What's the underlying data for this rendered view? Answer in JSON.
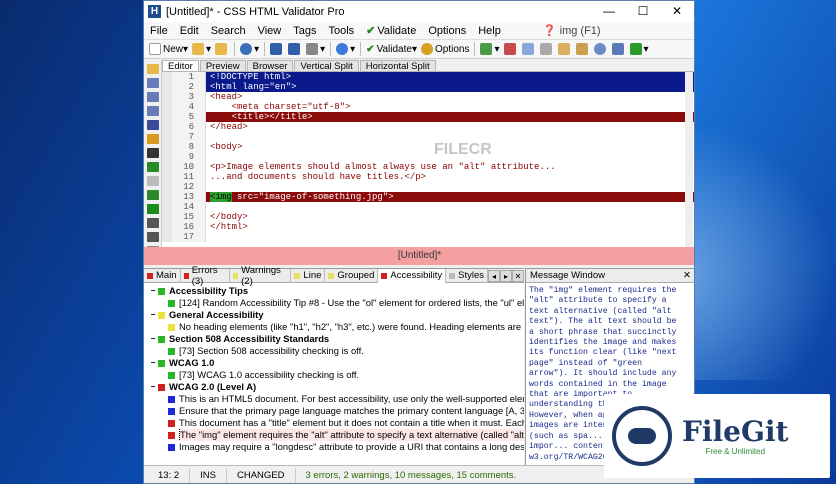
{
  "window": {
    "title": "[Untitled]* - CSS HTML Validator Pro",
    "app_icon_letter": "H",
    "min": "—",
    "max": "☐",
    "close": "✕"
  },
  "menu": {
    "items": [
      "File",
      "Edit",
      "Search",
      "View",
      "Tags",
      "Tools"
    ],
    "validate": "Validate",
    "options": "Options",
    "help": "Help",
    "img_help": "img (F1)"
  },
  "toolbar": {
    "new": "New",
    "validate": "Validate",
    "options": "Options"
  },
  "editor_tabs": [
    "Editor",
    "Preview",
    "Browser",
    "Vertical Split",
    "Horizontal Split"
  ],
  "editor": {
    "lines": [
      {
        "n": "1",
        "t": "<!DOCTYPE html>",
        "s": "sel"
      },
      {
        "n": "2",
        "t": "<html lang=\"en\">",
        "s": "sel"
      },
      {
        "n": "3",
        "t": "<head>",
        "s": ""
      },
      {
        "n": "4",
        "t": "    <meta charset=\"utf-8\">",
        "s": ""
      },
      {
        "n": "5",
        "t": "    <title></title>",
        "s": "err"
      },
      {
        "n": "6",
        "t": "</head>",
        "s": ""
      },
      {
        "n": "7",
        "t": "",
        "s": ""
      },
      {
        "n": "8",
        "t": "<body>",
        "s": ""
      },
      {
        "n": "9",
        "t": "",
        "s": ""
      },
      {
        "n": "10",
        "t": "<p>Image elements should almost always use an \"alt\" attribute...",
        "s": ""
      },
      {
        "n": "11",
        "t": "...and documents should have titles.</p>",
        "s": ""
      },
      {
        "n": "12",
        "t": "",
        "s": ""
      },
      {
        "n": "13",
        "t": " src=\"image-of-something.jpg\">",
        "s": "err",
        "tag": "<img"
      },
      {
        "n": "14",
        "t": "",
        "s": ""
      },
      {
        "n": "15",
        "t": "</body>",
        "s": ""
      },
      {
        "n": "16",
        "t": "</html>",
        "s": ""
      },
      {
        "n": "17",
        "t": "",
        "s": ""
      }
    ]
  },
  "file_tab": "[Untitled]*",
  "bottom_tabs": [
    {
      "label": "Main",
      "color": "#d02020"
    },
    {
      "label": "Errors (3)",
      "color": "#d02020"
    },
    {
      "label": "Warnings (2)",
      "color": "#e8e060"
    },
    {
      "label": "Line",
      "color": "#e8e060"
    },
    {
      "label": "Grouped",
      "color": "#e8e060"
    },
    {
      "label": "Accessibility",
      "color": "#d02020"
    },
    {
      "label": "Styles",
      "color": "#bbbbbb"
    }
  ],
  "tree": [
    {
      "kind": "h",
      "text": "Accessibility Tips",
      "color": "#27b827"
    },
    {
      "kind": "c",
      "text": "[124] Random Accessibility Tip #8 - Use the \"ol\" element for ordered lists, the \"ul\" ele...",
      "color": "#27b827"
    },
    {
      "kind": "h",
      "text": "General Accessibility",
      "color": "#f0e040"
    },
    {
      "kind": "c",
      "text": "No heading elements (like \"h1\", \"h2\", \"h3\", etc.) were found. Heading elements are im...",
      "color": "#f0e040"
    },
    {
      "kind": "h",
      "text": "Section 508 Accessibility Standards",
      "color": "#27b827"
    },
    {
      "kind": "c",
      "text": "[73] Section 508 accessibility checking is off.",
      "color": "#27b827"
    },
    {
      "kind": "h",
      "text": "WCAG 1.0",
      "color": "#27b827"
    },
    {
      "kind": "c",
      "text": "[73] WCAG 1.0 accessibility checking is off.",
      "color": "#27b827"
    },
    {
      "kind": "h",
      "text": "WCAG 2.0 (Level A)",
      "color": "#d02020"
    },
    {
      "kind": "c",
      "text": "This is an HTML5 document. For best accessibility, use only the well-supported element...",
      "color": "#1a2ad8"
    },
    {
      "kind": "c",
      "text": "Ensure that the primary page language matches the primary content language [A, 3.1....",
      "color": "#1a2ad8"
    },
    {
      "kind": "c",
      "text": "This document has a \"title\" element but it does not contain a title when it must. Each p...",
      "color": "#d02020"
    },
    {
      "kind": "c",
      "text": "The \"img\" element requires the \"alt\" attribute to specify a text alternative (called \"alt t...",
      "color": "#d02020",
      "hl": true
    },
    {
      "kind": "c",
      "text": "Images may require a \"longdesc\" attribute to provide a URI that contains a long descri...",
      "color": "#1a2ad8"
    }
  ],
  "message_window": {
    "title": "Message Window",
    "close": "✕",
    "text": "The \"img\" element requires the \"alt\" attribute to specify a text alternative (called \"alt text\"). The alt text should be a short phrase that succinctly identifies the image and makes its function clear (like \"next page\" instead of \"green arrow\"). It should include any words contained in the image that are important to understanding the content. However, when appropriate, images are intended ... page (such as spa... are not an impor... content. Vis... w3.org/TR/WCAG20..."
  },
  "status": {
    "pos": "13: 2",
    "mode": "INS",
    "changed": "CHANGED",
    "message": "3 errors, 2 warnings, 10 messages, 15 comments."
  },
  "watermark": {
    "name": "FileGit",
    "tagline": "Free & Unlimited",
    "center": "FILECR"
  }
}
